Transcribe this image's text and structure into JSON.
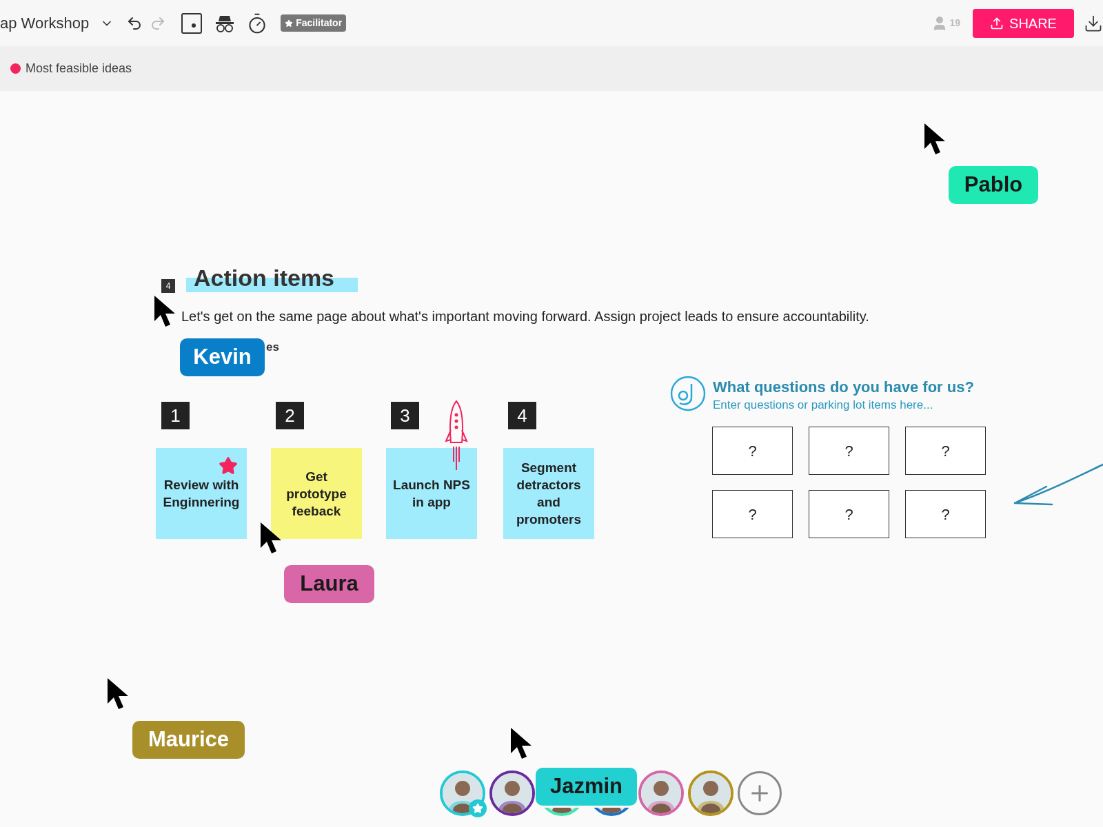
{
  "frame_title": "ap Workshop",
  "facilitator_badge": "Facilitator",
  "participant_count": "19",
  "share_button": "SHARE",
  "frame_label": {
    "text": "Most feasible ideas",
    "color": "#f2255f"
  },
  "cursors": [
    {
      "name": "Pablo",
      "color": "#1fe8b3"
    },
    {
      "name": "Kevin",
      "color": "#0a7fc9"
    },
    {
      "name": "Laura",
      "color": "#d966a6"
    },
    {
      "name": "Maurice",
      "color": "#a88f2a"
    },
    {
      "name": "Jazmin",
      "color": "#22d0d2"
    }
  ],
  "action_items": {
    "number": "4",
    "title": "Action items",
    "description": "Let's get on the same page about what's important moving forward. Assign project leads to ensure accountability.",
    "partial_text": "es"
  },
  "notes": [
    {
      "number": "1",
      "text": "Review with Enginnering",
      "color": "#a0ebfc",
      "kind": "star"
    },
    {
      "number": "2",
      "text": "Get prototype feeback",
      "color": "#f8f57c",
      "kind": "plain"
    },
    {
      "number": "3",
      "text": "Launch NPS in app",
      "color": "#a0ebfc",
      "kind": "rocket"
    },
    {
      "number": "4",
      "text": "Segment detractors and promoters",
      "color": "#a0ebfc",
      "kind": "plain"
    }
  ],
  "questions": {
    "title": "What questions do you have for us?",
    "subtitle": "Enter questions or parking lot items here...",
    "boxes": [
      "?",
      "?",
      "?",
      "?",
      "?",
      "?"
    ]
  },
  "avatars": [
    {
      "color": "#22c9d4",
      "host": true
    },
    {
      "color": "#6a2c9e",
      "host": false
    },
    {
      "color": "#3ee8b0"
    },
    {
      "color": "#1a73c8"
    },
    {
      "color": "#d566a8",
      "host": false
    },
    {
      "color": "#b3941c",
      "host": false
    }
  ]
}
